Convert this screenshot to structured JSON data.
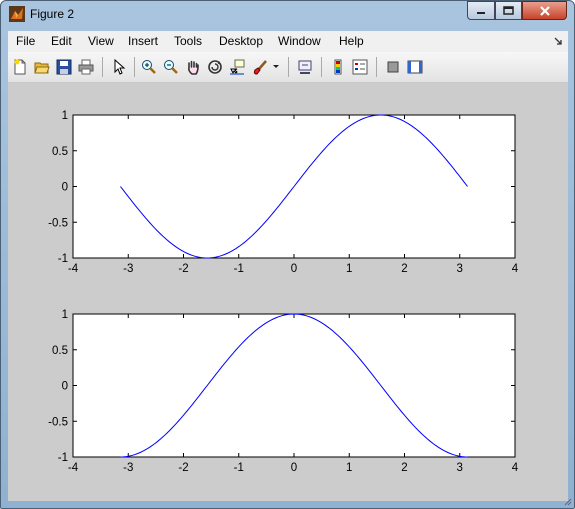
{
  "window": {
    "title": "Figure 2"
  },
  "menubar": {
    "items": [
      "File",
      "Edit",
      "View",
      "Insert",
      "Tools",
      "Desktop",
      "Window",
      "Help"
    ]
  },
  "toolbar": {
    "buttons": [
      "new-figure",
      "open-file",
      "save",
      "print",
      "edit-plot-arrow",
      "zoom-in",
      "zoom-out",
      "pan",
      "rotate-3d",
      "data-cursor",
      "brush",
      "insert-colorbar",
      "insert-legend",
      "hide-plot-tools",
      "show-plot-tools"
    ]
  },
  "colors": {
    "line": "#0000ff",
    "axes_bg": "#ffffff",
    "figure_bg": "#cccccc"
  },
  "chart_data": [
    {
      "type": "line",
      "function": "sin(x)",
      "title": "",
      "xlabel": "",
      "ylabel": "",
      "xlim": [
        -4,
        4
      ],
      "ylim": [
        -1,
        1
      ],
      "xticks": [
        "-4",
        "-3",
        "-2",
        "-1",
        "0",
        "1",
        "2",
        "3",
        "4"
      ],
      "yticks": [
        "-1",
        "-0.5",
        "0",
        "0.5",
        "1"
      ],
      "x": [
        -3.1416,
        -2.7489,
        -2.3562,
        -1.9635,
        -1.5708,
        -1.1781,
        -0.7854,
        -0.3927,
        0,
        0.3927,
        0.7854,
        1.1781,
        1.5708,
        1.9635,
        2.3562,
        2.7489,
        3.1416
      ],
      "y": [
        0,
        -0.3827,
        -0.7071,
        -0.9239,
        -1,
        -0.9239,
        -0.7071,
        -0.3827,
        0,
        0.3827,
        0.7071,
        0.9239,
        1,
        0.9239,
        0.7071,
        0.3827,
        0
      ],
      "grid": false
    },
    {
      "type": "line",
      "function": "cos(x)",
      "title": "",
      "xlabel": "",
      "ylabel": "",
      "xlim": [
        -4,
        4
      ],
      "ylim": [
        -1,
        1
      ],
      "xticks": [
        "-4",
        "-3",
        "-2",
        "-1",
        "0",
        "1",
        "2",
        "3",
        "4"
      ],
      "yticks": [
        "-1",
        "-0.5",
        "0",
        "0.5",
        "1"
      ],
      "x": [
        -3.1416,
        -2.7489,
        -2.3562,
        -1.9635,
        -1.5708,
        -1.1781,
        -0.7854,
        -0.3927,
        0,
        0.3927,
        0.7854,
        1.1781,
        1.5708,
        1.9635,
        2.3562,
        2.7489,
        3.1416
      ],
      "y": [
        -1,
        -0.9239,
        -0.7071,
        -0.3827,
        0,
        0.3827,
        0.7071,
        0.9239,
        1,
        0.9239,
        0.7071,
        0.3827,
        0,
        -0.3827,
        -0.7071,
        -0.9239,
        -1
      ],
      "grid": false
    }
  ]
}
